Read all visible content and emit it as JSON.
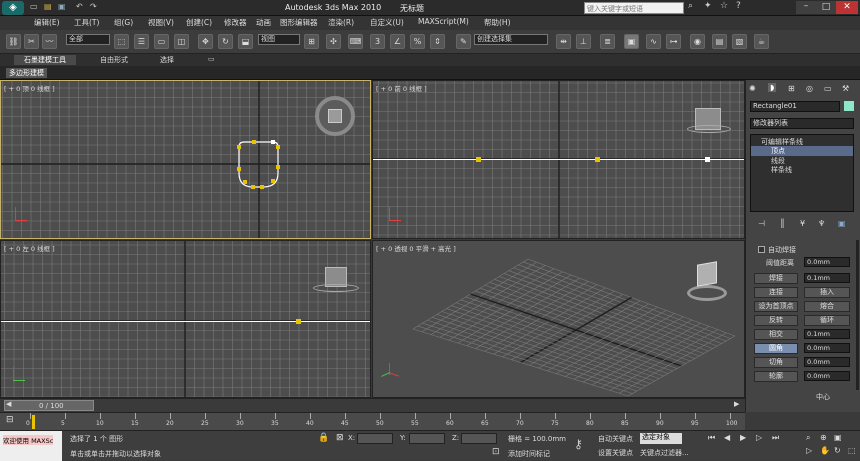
{
  "window": {
    "app_title": "Autodesk 3ds Max  2010",
    "doc_title": "无标题",
    "search_placeholder": "键入关键字或短语"
  },
  "menu": [
    "编辑(E)",
    "工具(T)",
    "组(G)",
    "视图(V)",
    "创建(C)",
    "修改器",
    "动画",
    "图形编辑器",
    "渲染(R)",
    "自定义(U)",
    "MAXScript(M)",
    "帮助(H)"
  ],
  "toolbar": {
    "filter_dropdown": "全部",
    "coord_dropdown": "视图",
    "selection_set": "创建选择集",
    "snap_label": "3"
  },
  "ribbon": {
    "tabs": [
      "石墨建模工具",
      "自由形式",
      "选择"
    ],
    "active_subtab": "多边形建模"
  },
  "viewports": {
    "top": "[ + 0 顶 0 线框 ]",
    "front": "[ + 0 前 0 线框 ]",
    "left": "[ + 0 左 0 线框 ]",
    "perspective": "[ + 0 透视 0 平滑 + 高光 ]"
  },
  "command_panel": {
    "object_name": "Rectangle01",
    "modifier_list": "修改器列表",
    "stack_items": [
      "可编辑样条线",
      "顶点",
      "线段",
      "样条线"
    ],
    "auto_weld": "自动焊接",
    "threshold_label": "阈值距离",
    "threshold_value": "0.0mm",
    "weld_label": "焊接",
    "weld_value": "0.1mm",
    "connect": "连接",
    "insert": "插入",
    "make_first": "设为首顶点",
    "fuse": "熔合",
    "reverse": "反转",
    "cycle": "循环",
    "crossinsert": "相交",
    "crossinsert_value": "0.1mm",
    "fillet": "圆角",
    "fillet_value": "0.0mm",
    "chamfer": "切角",
    "chamfer_value": "0.0mm",
    "outline": "轮廓",
    "outline_value": "0.0mm",
    "center": "中心"
  },
  "timeline": {
    "frame_readout": "0 / 100",
    "ticks": [
      "0",
      "5",
      "10",
      "15",
      "20",
      "25",
      "30",
      "35",
      "40",
      "45",
      "50",
      "55",
      "60",
      "65",
      "70",
      "75",
      "80",
      "85",
      "90",
      "95",
      "100"
    ]
  },
  "status": {
    "welcome": "欢迎使用 MAXSc",
    "selected": "选择了 1 个 图形",
    "prompt": "单击或单击并拖动以选择对象",
    "x_label": "X:",
    "y_label": "Y:",
    "z_label": "Z:",
    "grid": "栅格 = 100.0mm",
    "add_time_tag": "添加时间标记",
    "auto_key": "自动关键点",
    "set_key": "设置关键点",
    "selected_obj": "选定对象",
    "key_filters": "关键点过滤器..."
  },
  "colors": {
    "vertex": "#e8c400",
    "selected_vertex": "#ffffff",
    "active_border": "#c8b46a",
    "viewport_bg": "#4d4d4d",
    "grid_line": "#7a7a7a",
    "object_color": "#8ee8c8"
  }
}
